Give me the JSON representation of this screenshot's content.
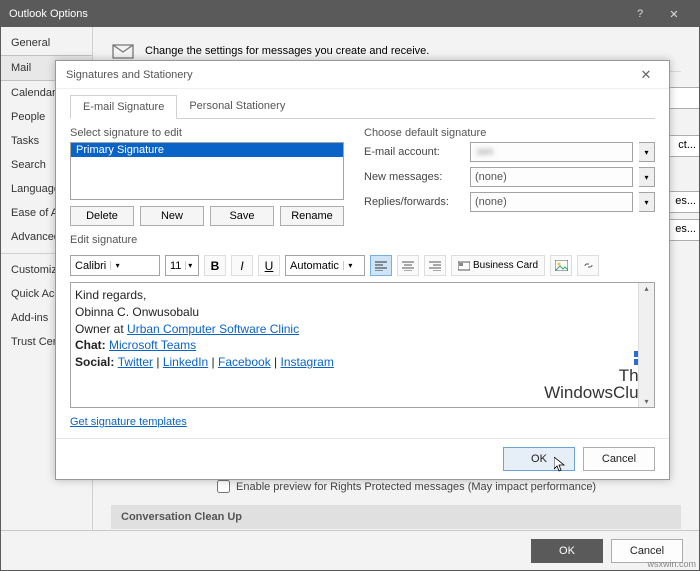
{
  "window": {
    "title": "Outlook Options",
    "help_icon": "?",
    "close_icon": "✕"
  },
  "sidebar": {
    "items": [
      "General",
      "Mail",
      "Calendar",
      "People",
      "Tasks",
      "Search",
      "Language",
      "Ease of Access",
      "Advanced"
    ],
    "selected_index": 1,
    "items2": [
      "Customize",
      "Quick Access",
      "Add-ins",
      "Trust Center"
    ]
  },
  "content": {
    "header": "Change the settings for messages you create and receive.",
    "rt_buttons": [
      "",
      "",
      "ct...",
      "es...",
      "es..."
    ],
    "preview_cb": "Enable preview for Rights Protected messages (May impact performance)",
    "section": "Conversation Clean Up"
  },
  "bottom": {
    "ok": "OK",
    "cancel": "Cancel"
  },
  "dialog": {
    "title": "Signatures and Stationery",
    "tabs": [
      "E-mail Signature",
      "Personal Stationery"
    ],
    "left": {
      "label": "Select signature to edit",
      "sel_item": "Primary Signature",
      "buttons": {
        "delete": "Delete",
        "new": "New",
        "save": "Save",
        "rename": "Rename"
      }
    },
    "right": {
      "label": "Choose default signature",
      "account_lbl": "E-mail account:",
      "account_val": ":om",
      "newmsg_lbl": "New messages:",
      "newmsg_val": "(none)",
      "repl_lbl": "Replies/forwards:",
      "repl_val": "(none)"
    },
    "edit_label": "Edit signature",
    "toolbar": {
      "font": "Calibri",
      "size": "11",
      "color": "Automatic",
      "bizcard": "Business Card"
    },
    "sig": {
      "l1": "Kind regards,",
      "l2": "Obinna C. Onwusobalu",
      "l3a": "Owner at ",
      "l3b": "Urban Computer Software Clinic",
      "l4a": "Chat: ",
      "l4b": "Microsoft Teams",
      "l5a": "Social: ",
      "tw": "Twitter",
      "li": "LinkedIn",
      "fb": "Facebook",
      "ig": "Instagram",
      "sep": " | "
    },
    "templates_link": "Get signature templates",
    "ok": "OK",
    "cancel": "Cancel"
  },
  "watermark": {
    "l1": "The",
    "l2": "WindowsClub"
  },
  "attr": "wsxwin.com"
}
